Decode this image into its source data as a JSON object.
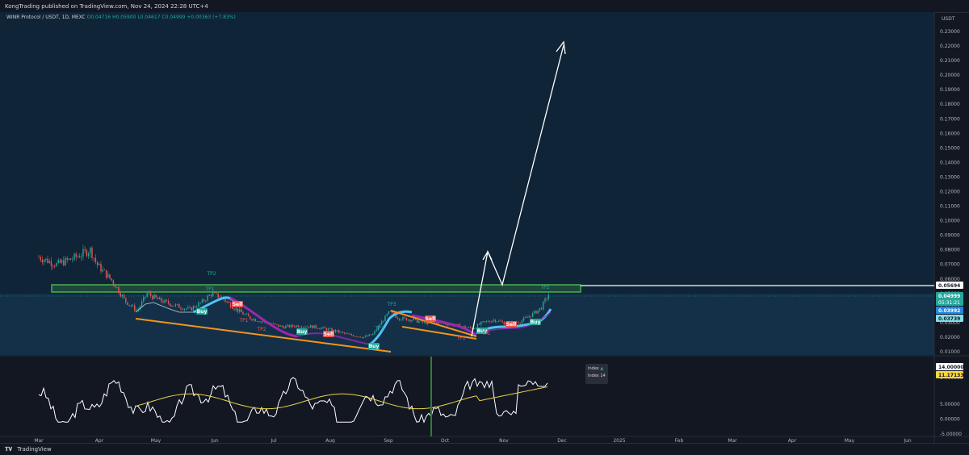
{
  "header": {
    "published_line": "KongTrading published on TradingView.com, Nov 24, 2024 22:28 UTC+4"
  },
  "legend": {
    "symbol": "WINR Protocol / USDT, 1D, MEXC",
    "open": "O0.04716",
    "high": "H0.05900",
    "low": "L0.04617",
    "close": "C0.04999",
    "change": "+0.00363 (+7.83%)"
  },
  "price_axis": {
    "currency": "USDT",
    "ticks": [
      "0.23000",
      "0.22000",
      "0.21000",
      "0.20000",
      "0.19000",
      "0.18000",
      "0.17000",
      "0.16000",
      "0.15000",
      "0.14000",
      "0.13000",
      "0.12000",
      "0.11000",
      "0.10000",
      "0.09000",
      "0.08000",
      "0.07000",
      "0.06000",
      "0.05000",
      "0.04000",
      "0.03000",
      "0.02000",
      "0.01000"
    ],
    "labels": {
      "resistance": "0.05694",
      "last_price": "0.04999",
      "countdown": "05:31:21",
      "ma1": "0.03992",
      "ma2": "0.03739"
    }
  },
  "indicator_axis": {
    "ticks": [
      "14.00000",
      "5.00000",
      "0.00000",
      "-5.00000"
    ],
    "labels": {
      "index": "14.00000",
      "signal": "11.17133"
    }
  },
  "time_axis": {
    "labels": [
      "Mar",
      "Apr",
      "May",
      "Jun",
      "Jul",
      "Aug",
      "Sep",
      "Oct",
      "Nov",
      "Dec",
      "2025",
      "Feb",
      "Mar",
      "Apr",
      "May",
      "Jun"
    ]
  },
  "tooltip": {
    "line1": "Index",
    "line2": "Index 14"
  },
  "markers": {
    "tp_labels": [
      "TP2",
      "TP1",
      "TP1",
      "TP2",
      "TP3",
      "TP3",
      "TP1",
      "TP1",
      "TP2"
    ],
    "buy_label": "Buy",
    "sell_label": "Sell"
  },
  "chart_data": {
    "type": "candlestick",
    "title": "WINR Protocol / USDT, 1D, MEXC",
    "xlabel": "",
    "ylabel": "",
    "x_labels": [
      "Mar",
      "Apr",
      "May",
      "Jun",
      "Jul",
      "Aug",
      "Sep",
      "Oct",
      "Nov",
      "Dec"
    ],
    "price_ylim": [
      0.01,
      0.235
    ],
    "resistance_zone": [
      0.0555,
      0.0615
    ],
    "resistance_level": 0.05694,
    "last_price": 0.04999,
    "approx_close_path": [
      {
        "x": "Mar",
        "y": 0.075
      },
      {
        "x": "Mar-mid",
        "y": 0.072
      },
      {
        "x": "Apr",
        "y": 0.07
      },
      {
        "x": "Apr-mid",
        "y": 0.055
      },
      {
        "x": "May",
        "y": 0.042
      },
      {
        "x": "May-mid",
        "y": 0.04
      },
      {
        "x": "Jun",
        "y": 0.047
      },
      {
        "x": "Jun-mid",
        "y": 0.038
      },
      {
        "x": "Jul",
        "y": 0.03
      },
      {
        "x": "Jul-mid",
        "y": 0.026
      },
      {
        "x": "Aug",
        "y": 0.024
      },
      {
        "x": "Aug-mid",
        "y": 0.02
      },
      {
        "x": "Sep",
        "y": 0.034
      },
      {
        "x": "Sep-mid",
        "y": 0.032
      },
      {
        "x": "Oct",
        "y": 0.029
      },
      {
        "x": "Oct-mid",
        "y": 0.026
      },
      {
        "x": "Nov",
        "y": 0.03
      },
      {
        "x": "Nov-mid",
        "y": 0.037
      },
      {
        "x": "Nov-end",
        "y": 0.05
      }
    ],
    "projection": [
      {
        "x": "Nov",
        "y": 0.05
      },
      {
        "x": "Nov-mid",
        "y": 0.083
      },
      {
        "x": "Nov-end",
        "y": 0.057
      },
      {
        "x": "Dec",
        "y": 0.225
      }
    ],
    "indicator": {
      "name": "Index",
      "ylim": [
        -5,
        15
      ],
      "series": [
        {
          "name": "Index",
          "color": "#ffffff"
        },
        {
          "name": "Index 14",
          "color": "#e8d44d"
        }
      ]
    }
  },
  "colors": {
    "background": "#131722",
    "pane": "#0f2436",
    "zone": "#4caf50",
    "up": "#26a69a",
    "down": "#ef5350",
    "trendline": "#f7931a",
    "projection": "#ffffff",
    "signal": "#e8d44d"
  }
}
